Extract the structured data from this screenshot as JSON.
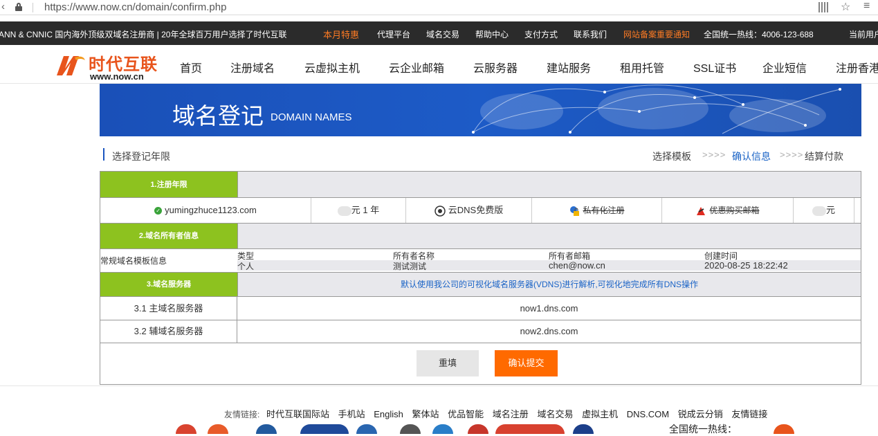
{
  "browser": {
    "url": "https://www.now.cn/domain/confirm.php"
  },
  "topbar": {
    "tagline": "ANN & CNNIC 国内海外顶级双域名注册商 | 20年全球百万用户选择了时代互联",
    "hot": "本月特惠",
    "links": [
      "代理平台",
      "域名交易",
      "帮助中心",
      "支付方式",
      "联系我们"
    ],
    "notice": "网站备案重要通知",
    "hotline": "全国统一热线：4006-123-688",
    "current_user": "当前用户"
  },
  "header": {
    "logo_cn": "时代互联",
    "logo_en": "www.now.cn",
    "nav": [
      "首页",
      "注册域名",
      "云虚拟主机",
      "云企业邮箱",
      "云服务器",
      "建站服务",
      "租用托管",
      "SSL证书",
      "企业短信",
      "注册香港"
    ]
  },
  "banner": {
    "title": "域名登记",
    "subtitle": "DOMAIN NAMES"
  },
  "steps": {
    "title": "选择登记年限",
    "items": [
      "选择模板",
      "确认信息",
      "结算付款"
    ],
    "arrows": ">>>>",
    "active_index": 1
  },
  "section1": {
    "label": "1.注册年限",
    "domain": "yumingzhuce1123.com",
    "price_suffix": "元 1 年",
    "dns": "云DNS免费版",
    "privacy": "私有化注册",
    "mail": "优惠购买邮箱",
    "total_suffix": "元"
  },
  "section2": {
    "label": "2.域名所有者信息",
    "row_label": "常规域名模板信息",
    "headers": [
      "类型",
      "所有者名称",
      "所有者邮箱",
      "创建时间"
    ],
    "values": [
      "个人",
      "测试测试",
      "chen@now.cn",
      "2020-08-25 18:22:42"
    ]
  },
  "section3": {
    "label": "3.域名服务器",
    "notice": "默认使用我公司的可视化域名服务器(VDNS)进行解析,可视化地完成所有DNS操作",
    "primary_label": "3.1 主域名服务器",
    "primary_value": "now1.dns.com",
    "secondary_label": "3.2 辅域名服务器",
    "secondary_value": "now2.dns.com"
  },
  "actions": {
    "reset": "重填",
    "confirm": "确认提交"
  },
  "footer": {
    "links_label": "友情链接:",
    "links": [
      "时代互联国际站",
      "手机站",
      "English",
      "繁体站",
      "优品智能",
      "域名注册",
      "域名交易",
      "虚拟主机",
      "DNS.COM",
      "锐成云分销",
      "友情链接"
    ],
    "hotline": "全国统一热线："
  },
  "colors": {
    "accent_orange": "#ff6a00",
    "green": "#8dc21f",
    "banner_blue": "#1d5bc7",
    "link_blue": "#1a63c6"
  }
}
